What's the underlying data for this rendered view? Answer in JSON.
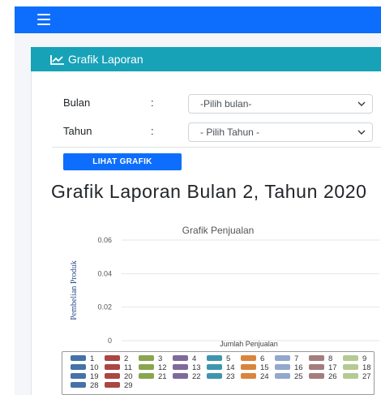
{
  "topbar": {
    "menu_icon": "hamburger-menu-icon",
    "color": "#0d6efd"
  },
  "card": {
    "header_title": "Grafik Laporan",
    "header_icon": "chart-line-icon",
    "header_color": "#17a2b8"
  },
  "form": {
    "bulan_label": "Bulan",
    "bulan_colon": ":",
    "bulan_value": "-Pilih bulan-",
    "tahun_label": "Tahun",
    "tahun_colon": ":",
    "tahun_value": "- Pilih Tahun -",
    "submit_label": "LIHAT GRAFIK"
  },
  "report": {
    "title": "Grafik Laporan Bulan 2, Tahun 2020"
  },
  "chart_data": {
    "type": "bar",
    "title": "Grafik Penjualan",
    "xlabel": "Jumlah Penjualan",
    "ylabel": "Pembelian Produk",
    "ylim": [
      0,
      0.06
    ],
    "yticks": [
      "0",
      "0.02",
      "0.04",
      "0.06"
    ],
    "grid": true,
    "legend_placement": "bottom",
    "series": [
      {
        "name": "1",
        "color": "#4572a7",
        "values": [
          0
        ]
      },
      {
        "name": "2",
        "color": "#aa4643",
        "values": [
          0
        ]
      },
      {
        "name": "3",
        "color": "#89a54e",
        "values": [
          0
        ]
      },
      {
        "name": "4",
        "color": "#80699b",
        "values": [
          0
        ]
      },
      {
        "name": "5",
        "color": "#3d96ae",
        "values": [
          0
        ]
      },
      {
        "name": "6",
        "color": "#db843d",
        "values": [
          0
        ]
      },
      {
        "name": "7",
        "color": "#92a8cd",
        "values": [
          0
        ]
      },
      {
        "name": "8",
        "color": "#a47d7c",
        "values": [
          0
        ]
      },
      {
        "name": "9",
        "color": "#b5ca92",
        "values": [
          0
        ]
      },
      {
        "name": "10",
        "color": "#4572a7",
        "values": [
          0
        ]
      },
      {
        "name": "11",
        "color": "#aa4643",
        "values": [
          0
        ]
      },
      {
        "name": "12",
        "color": "#89a54e",
        "values": [
          0
        ]
      },
      {
        "name": "13",
        "color": "#80699b",
        "values": [
          0
        ]
      },
      {
        "name": "14",
        "color": "#3d96ae",
        "values": [
          0
        ]
      },
      {
        "name": "15",
        "color": "#db843d",
        "values": [
          0
        ]
      },
      {
        "name": "16",
        "color": "#92a8cd",
        "values": [
          0
        ]
      },
      {
        "name": "17",
        "color": "#a47d7c",
        "values": [
          0
        ]
      },
      {
        "name": "18",
        "color": "#b5ca92",
        "values": [
          0
        ]
      },
      {
        "name": "19",
        "color": "#4572a7",
        "values": [
          0
        ]
      },
      {
        "name": "20",
        "color": "#aa4643",
        "values": [
          0
        ]
      },
      {
        "name": "21",
        "color": "#89a54e",
        "values": [
          0
        ]
      },
      {
        "name": "22",
        "color": "#80699b",
        "values": [
          0
        ]
      },
      {
        "name": "23",
        "color": "#3d96ae",
        "values": [
          0
        ]
      },
      {
        "name": "24",
        "color": "#db843d",
        "values": [
          0
        ]
      },
      {
        "name": "25",
        "color": "#92a8cd",
        "values": [
          0
        ]
      },
      {
        "name": "26",
        "color": "#a47d7c",
        "values": [
          0
        ]
      },
      {
        "name": "27",
        "color": "#b5ca92",
        "values": [
          0
        ]
      },
      {
        "name": "28",
        "color": "#4572a7",
        "values": [
          0
        ]
      },
      {
        "name": "29",
        "color": "#aa4643",
        "values": [
          0
        ]
      }
    ]
  }
}
